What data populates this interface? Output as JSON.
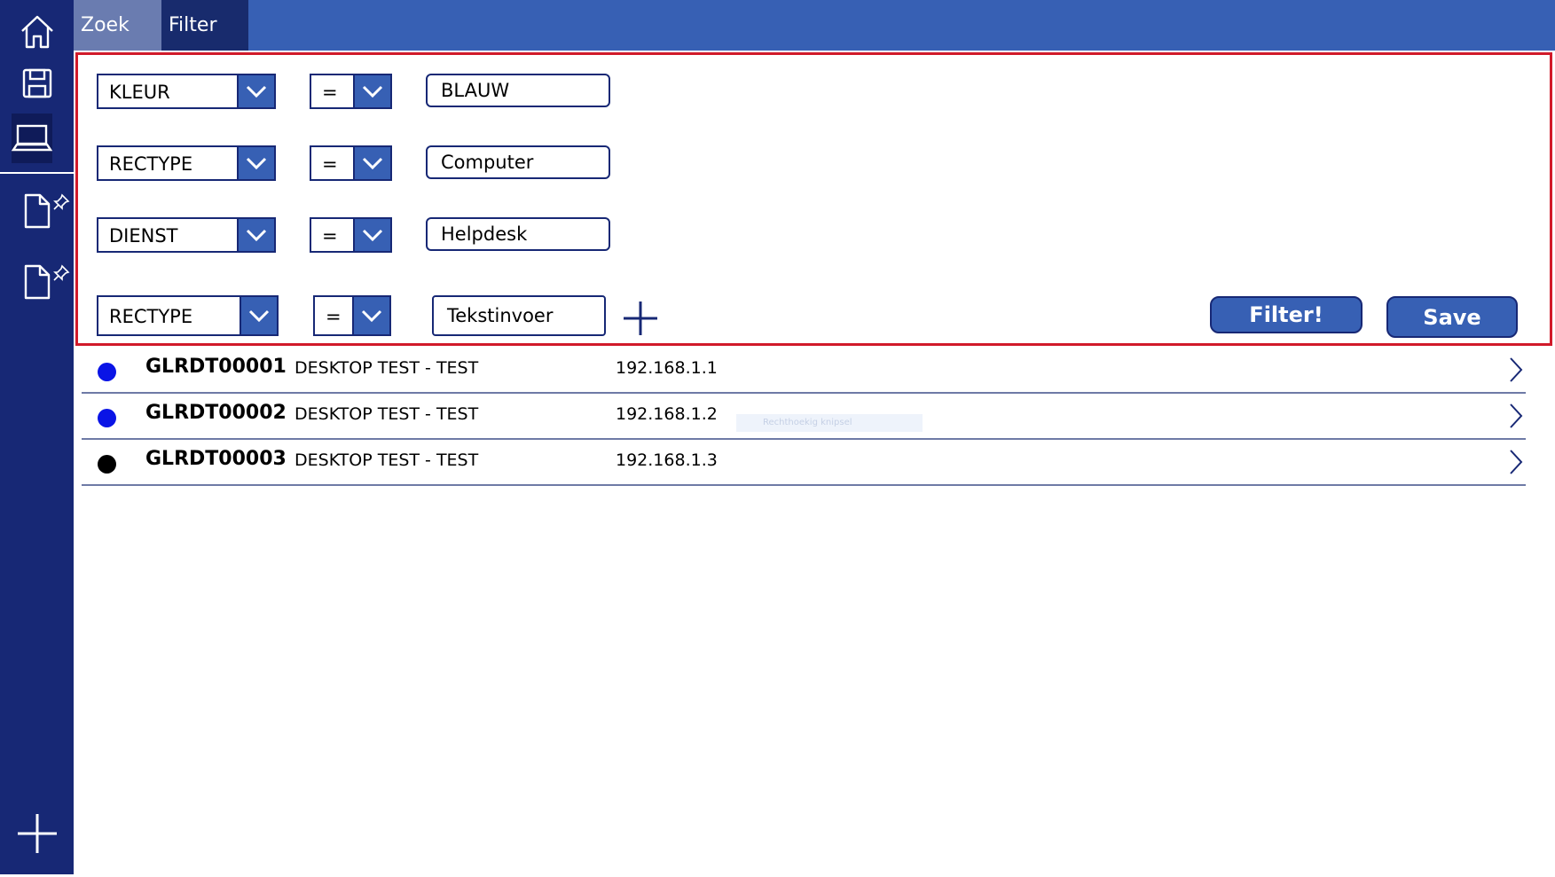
{
  "header": {
    "tabs": [
      {
        "label": "Zoek"
      },
      {
        "label": "Filter"
      }
    ]
  },
  "nav": {
    "items": [
      {
        "icon": "home-icon"
      },
      {
        "icon": "save-icon"
      },
      {
        "icon": "laptop-icon",
        "active": true
      },
      {
        "icon": "document-icon",
        "pinned": true
      },
      {
        "icon": "document-icon",
        "pinned": true
      },
      {
        "icon": "plus-icon"
      }
    ]
  },
  "filters": [
    {
      "field": "KLEUR",
      "operator": "=",
      "value": "BLAUW"
    },
    {
      "field": "RECTYPE",
      "operator": "=",
      "value": "Computer"
    },
    {
      "field": "DIENST",
      "operator": "=",
      "value": "Helpdesk"
    }
  ],
  "new_filter": {
    "field": "RECTYPE",
    "operator": "=",
    "placeholder": "Tekstinvoer"
  },
  "buttons": {
    "filter": "Filter!",
    "save": "Save"
  },
  "results": [
    {
      "id": "GLRDT00001",
      "description": "DESKTOP TEST - TEST",
      "ip": "192.168.1.1",
      "status_color": "#0a14e6"
    },
    {
      "id": "GLRDT00002",
      "description": "DESKTOP TEST - TEST",
      "ip": "192.168.1.2",
      "status_color": "#0a14e6"
    },
    {
      "id": "GLRDT00003",
      "description": "DESKTOP TEST - TEST",
      "ip": "192.168.1.3",
      "status_color": "#000000"
    }
  ],
  "overlay_text": "Rechthoekig knipsel",
  "colors": {
    "nav_bg": "#172875",
    "header_bg": "#3760b4",
    "accent": "#3760b4",
    "panel_border": "#d11a2a"
  }
}
